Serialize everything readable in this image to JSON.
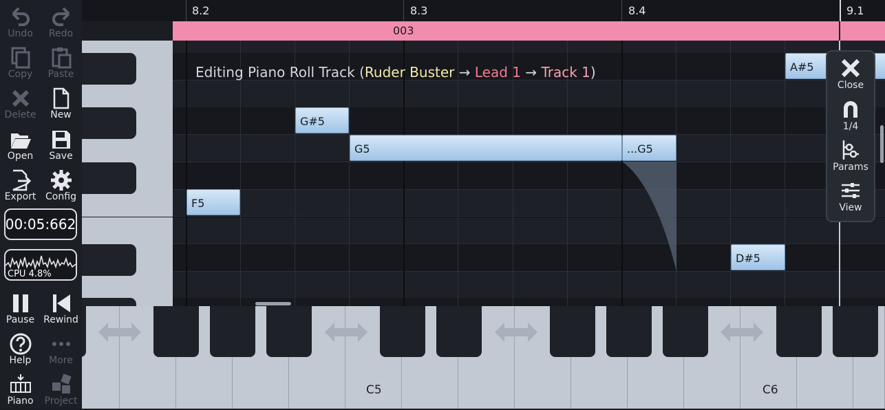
{
  "sidebar": {
    "undo": "Undo",
    "redo": "Redo",
    "copy": "Copy",
    "paste": "Paste",
    "delete": "Delete",
    "new": "New",
    "open": "Open",
    "save": "Save",
    "export": "Export",
    "config": "Config",
    "time": "00:05:662",
    "cpu": "CPU 4.8%",
    "pause": "Pause",
    "rewind": "Rewind",
    "help": "Help",
    "more": "More",
    "piano": "Piano",
    "project": "Project"
  },
  "ruler": {
    "m82": "8.2",
    "m83": "8.3",
    "m84": "8.4",
    "m91": "9.1"
  },
  "clip": {
    "name": "003"
  },
  "title": {
    "prefix": "Editing Piano Roll Track (",
    "song": "Ruder Buster",
    "arrow1": " → ",
    "instrument": "Lead 1",
    "arrow2": " → ",
    "track": "Track 1",
    "suffix": ")"
  },
  "notes": {
    "a_sharp_5": "A#5",
    "g_sharp_5": "G#5",
    "g5": "G5",
    "g5_cont": "...G5",
    "f5": "F5",
    "d_sharp_5": "D#5"
  },
  "panel": {
    "close": "Close",
    "snap": "1/4",
    "params": "Params",
    "view": "View"
  },
  "keyboard": {
    "c5": "C5",
    "c6": "C6"
  },
  "colors": {
    "clip": "#f18cae",
    "note": "#b7d5f0",
    "song": "#f5e9a8",
    "instrument": "#f47c90"
  }
}
